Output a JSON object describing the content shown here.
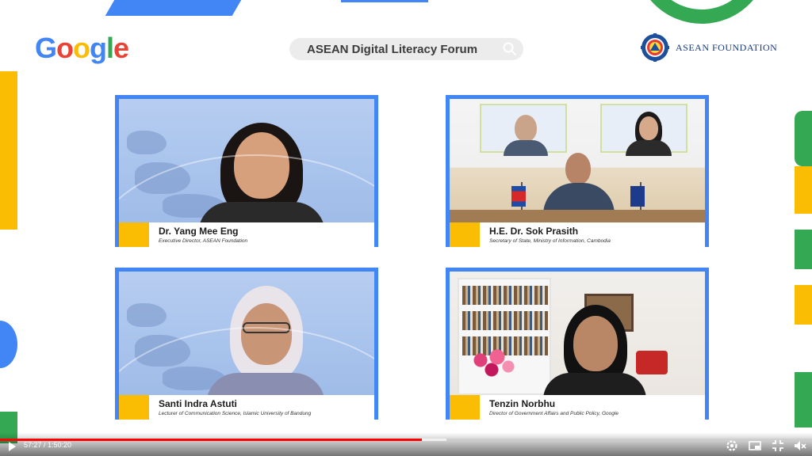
{
  "header": {
    "google_logo_letters": [
      {
        "char": "G",
        "color": "#4285f4"
      },
      {
        "char": "o",
        "color": "#ea4335"
      },
      {
        "char": "o",
        "color": "#fbbc04"
      },
      {
        "char": "g",
        "color": "#4285f4"
      },
      {
        "char": "l",
        "color": "#34a853"
      },
      {
        "char": "e",
        "color": "#ea4335"
      }
    ],
    "forum_title": "ASEAN Digital Literacy Forum",
    "search_icon": "search-icon",
    "partner_name": "ASEAN FOUNDATION"
  },
  "speakers": [
    {
      "name": "Dr. Yang Mee Eng",
      "role": "Executive Director, ASEAN Foundation"
    },
    {
      "name": "H.E. Dr. Sok Prasith",
      "role": "Secretary of State, Ministry of Information, Cambodia"
    },
    {
      "name": "Santi Indra Astuti",
      "role": "Lecturer of Communication Science, Islamic University of Bandung"
    },
    {
      "name": "Tenzin Norbhu",
      "role": "Director of Government Affairs and Public Policy, Google"
    }
  ],
  "player": {
    "time_display": "57:27 / 1:50:20",
    "progress_fraction": 0.52,
    "buffer_fraction": 0.55,
    "icons": [
      "play-icon",
      "settings-icon",
      "picture-in-picture-icon",
      "fullscreen-exit-icon",
      "volume-muted-icon"
    ]
  },
  "colors": {
    "google_blue": "#4285f4",
    "google_red": "#ea4335",
    "google_yellow": "#fbbc04",
    "google_green": "#34a853",
    "progress_red": "#ff0000"
  }
}
